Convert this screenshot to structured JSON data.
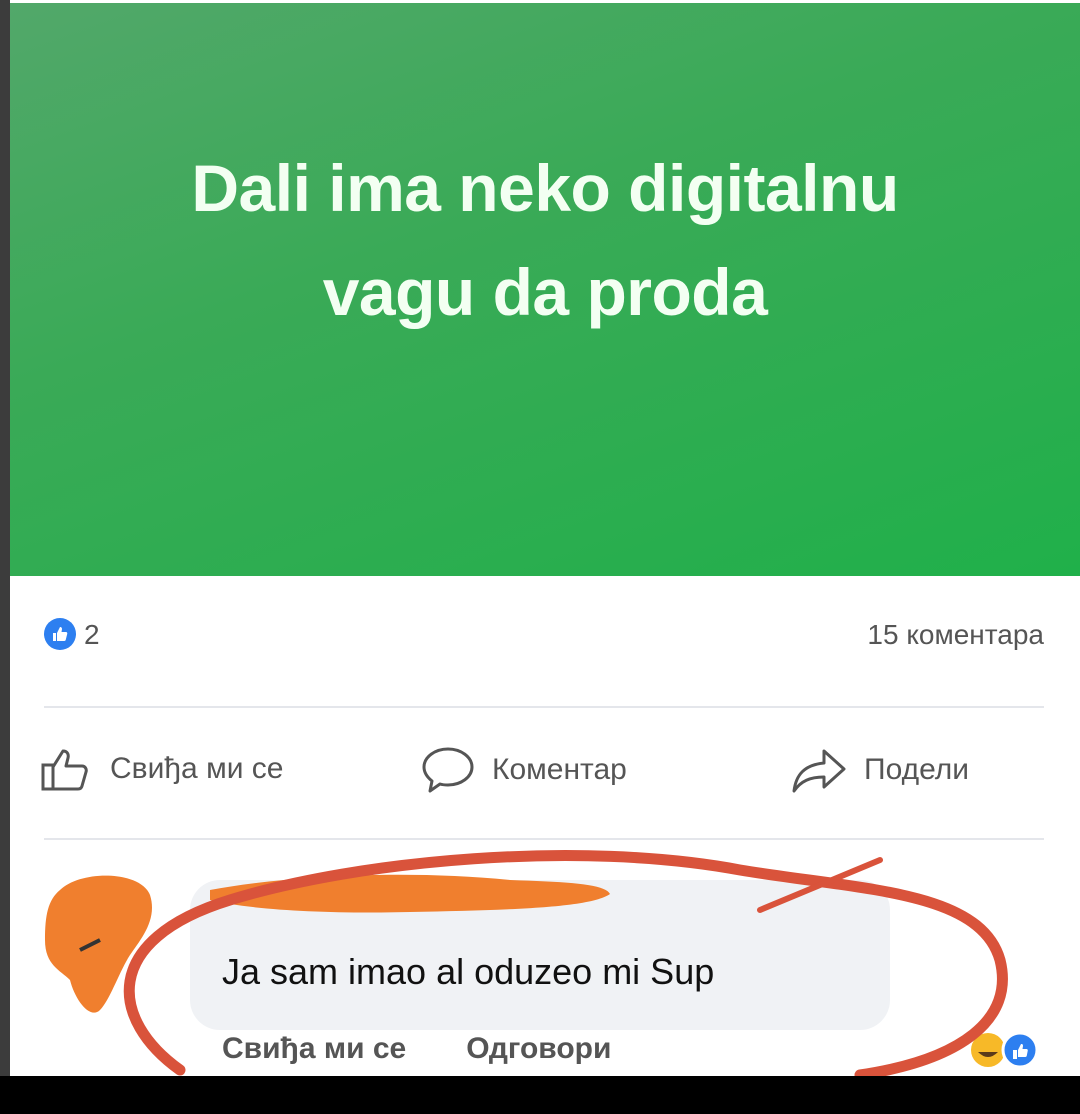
{
  "post": {
    "headline": "Dali ima neko digitalnu vagu da proda",
    "background_color": "#34ad55"
  },
  "stats": {
    "like_count": "2",
    "comments_label": "15 коментара"
  },
  "actions": {
    "like_label": "Свиђа ми се",
    "comment_label": "Коментар",
    "share_label": "Подели"
  },
  "comment": {
    "text": "Ja sam imao al oduzeo mi Sup",
    "like_label": "Свиђа ми се",
    "reply_label": "Одговори",
    "reactions": [
      "laugh-reaction-icon",
      "like-reaction-icon"
    ]
  },
  "colors": {
    "accent_blue": "#2d7ff0",
    "annotation_red": "#d9533b",
    "redaction_orange": "#f07f2e"
  }
}
